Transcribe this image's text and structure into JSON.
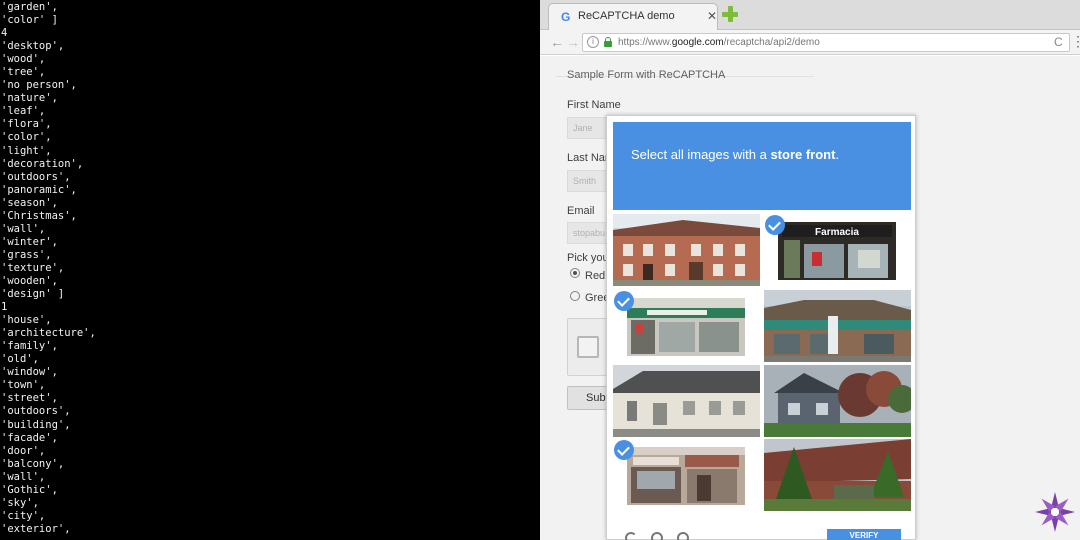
{
  "terminal": {
    "lines": [
      "'garden',",
      "'color' ]",
      "4",
      "'desktop',",
      "'wood',",
      "'tree',",
      "'no person',",
      "'nature',",
      "'leaf',",
      "'flora',",
      "'color',",
      "'light',",
      "'decoration',",
      "'outdoors',",
      "'panoramic',",
      "'season',",
      "'Christmas',",
      "'wall',",
      "'winter',",
      "'grass',",
      "'texture',",
      "'wooden',",
      "'design' ]",
      "1",
      "'house',",
      "'architecture',",
      "'family',",
      "'old',",
      "'window',",
      "'town',",
      "'street',",
      "'outdoors',",
      "'building',",
      "'facade',",
      "'door',",
      "'balcony',",
      "'wall',",
      "'Gothic',",
      "'sky',",
      "'city',",
      "'exterior',"
    ]
  },
  "browser": {
    "tab_title": "ReCAPTCHA demo",
    "tab_favicon": "G",
    "tab_close": "✕",
    "back_icon": "←",
    "forward_icon": "→",
    "info_icon": "i",
    "url_prefix": "https://www.",
    "url_domain": "google.com",
    "url_path": "/recaptcha/api2/demo",
    "reload_icon": "C",
    "menu_icon": "⋮"
  },
  "form": {
    "legend": "Sample Form with ReCAPTCHA",
    "first_name_label": "First Name",
    "first_name_placeholder": "Jane",
    "last_name_label": "Last Nam",
    "last_name_placeholder": "Smith",
    "email_label": "Email",
    "email_placeholder": "stopabu",
    "pick_label": "Pick you",
    "radio_red_label": "Red",
    "radio_green_label": "Gree",
    "submit_label": "Subm"
  },
  "challenge": {
    "prompt_prefix": "Select all images with a ",
    "prompt_target": "store front",
    "prompt_suffix": ".",
    "tiles": [
      {
        "name": "brick-house",
        "selected": false
      },
      {
        "name": "farmacia-storefront",
        "selected": true,
        "sign": "Farmacia"
      },
      {
        "name": "shop-with-awning",
        "selected": true
      },
      {
        "name": "corner-store-green",
        "selected": false
      },
      {
        "name": "white-warehouse",
        "selected": false
      },
      {
        "name": "house-with-trees",
        "selected": false
      },
      {
        "name": "shop-with-sign",
        "selected": true
      },
      {
        "name": "trees-and-building",
        "selected": false
      }
    ],
    "verify_label": "VERIFY"
  },
  "colors": {
    "accent": "#4a90e2",
    "terminal_bg": "#000000",
    "terminal_text": "#f2f2f2",
    "logo": "#7b3fa8"
  }
}
